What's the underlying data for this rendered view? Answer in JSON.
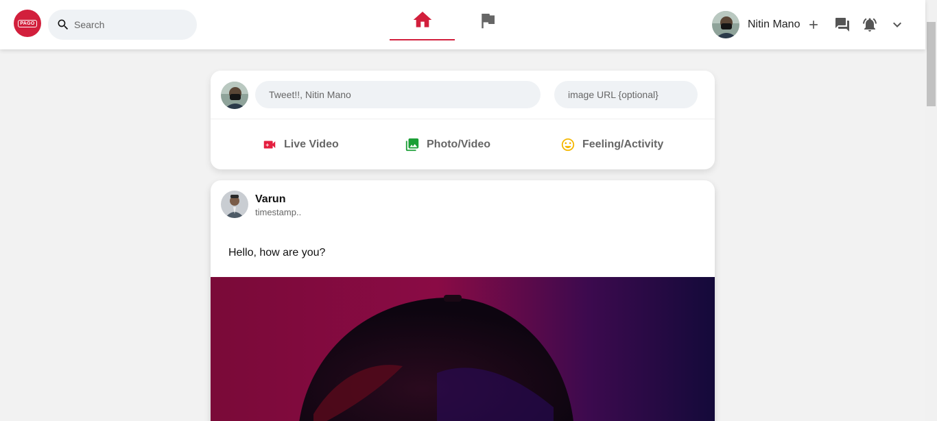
{
  "header": {
    "logo_text": "PAGO",
    "search": {
      "placeholder": "Search"
    },
    "nav": [
      {
        "name": "home",
        "icon": "home-icon",
        "active": true
      },
      {
        "name": "flag",
        "icon": "flag-icon",
        "active": false
      }
    ],
    "user": {
      "name": "Nitin Mano"
    },
    "icons": [
      "add-icon",
      "forum-icon",
      "notifications-icon",
      "expand-more-icon"
    ]
  },
  "composer": {
    "tweet_placeholder": "Tweet!!, Nitin Mano",
    "image_url_placeholder": "image URL {optional}",
    "actions": [
      {
        "label": "Live Video",
        "icon": "videocam-icon",
        "color": "#e41e3f"
      },
      {
        "label": "Photo/Video",
        "icon": "photo-library-icon",
        "color": "#1b9e36"
      },
      {
        "label": "Feeling/Activity",
        "icon": "emoji-icon",
        "color": "#f5b700"
      }
    ]
  },
  "post": {
    "author": "Varun",
    "timestamp": "timestamp..",
    "text": "Hello, how are you?"
  },
  "colors": {
    "accent": "#d21f3c",
    "background": "#f2f2f2"
  }
}
